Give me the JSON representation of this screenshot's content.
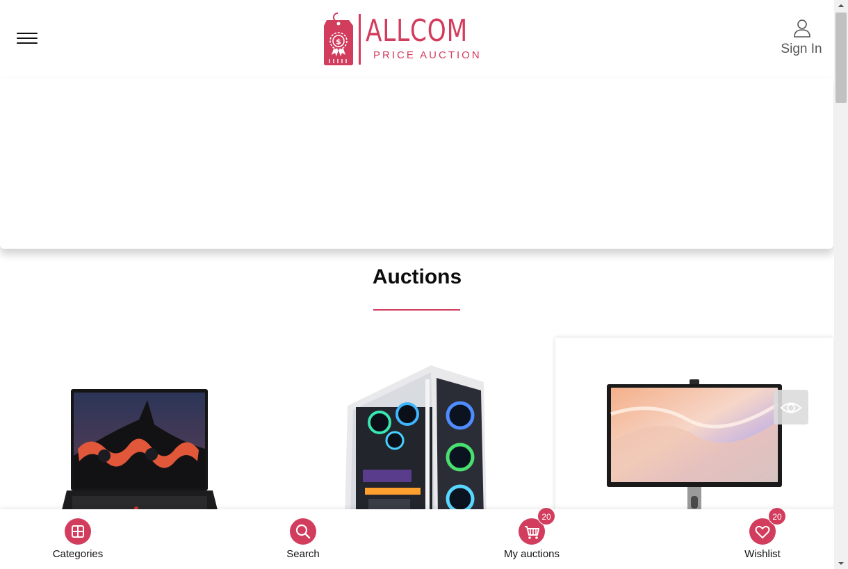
{
  "header": {
    "brand_name": "ALLCOM",
    "brand_tagline": "PRICE AUCTION",
    "signin_label": "Sign In"
  },
  "section": {
    "title": "Auctions"
  },
  "products": [
    {
      "image": "laptop"
    },
    {
      "image": "gaming-pc-tower"
    },
    {
      "image": "monitor"
    }
  ],
  "bottom_nav": {
    "categories_label": "Categories",
    "search_label": "Search",
    "my_auctions_label": "My auctions",
    "my_auctions_count": "20",
    "wishlist_label": "Wishlist",
    "wishlist_count": "20"
  },
  "colors": {
    "accent": "#d23c5d"
  }
}
